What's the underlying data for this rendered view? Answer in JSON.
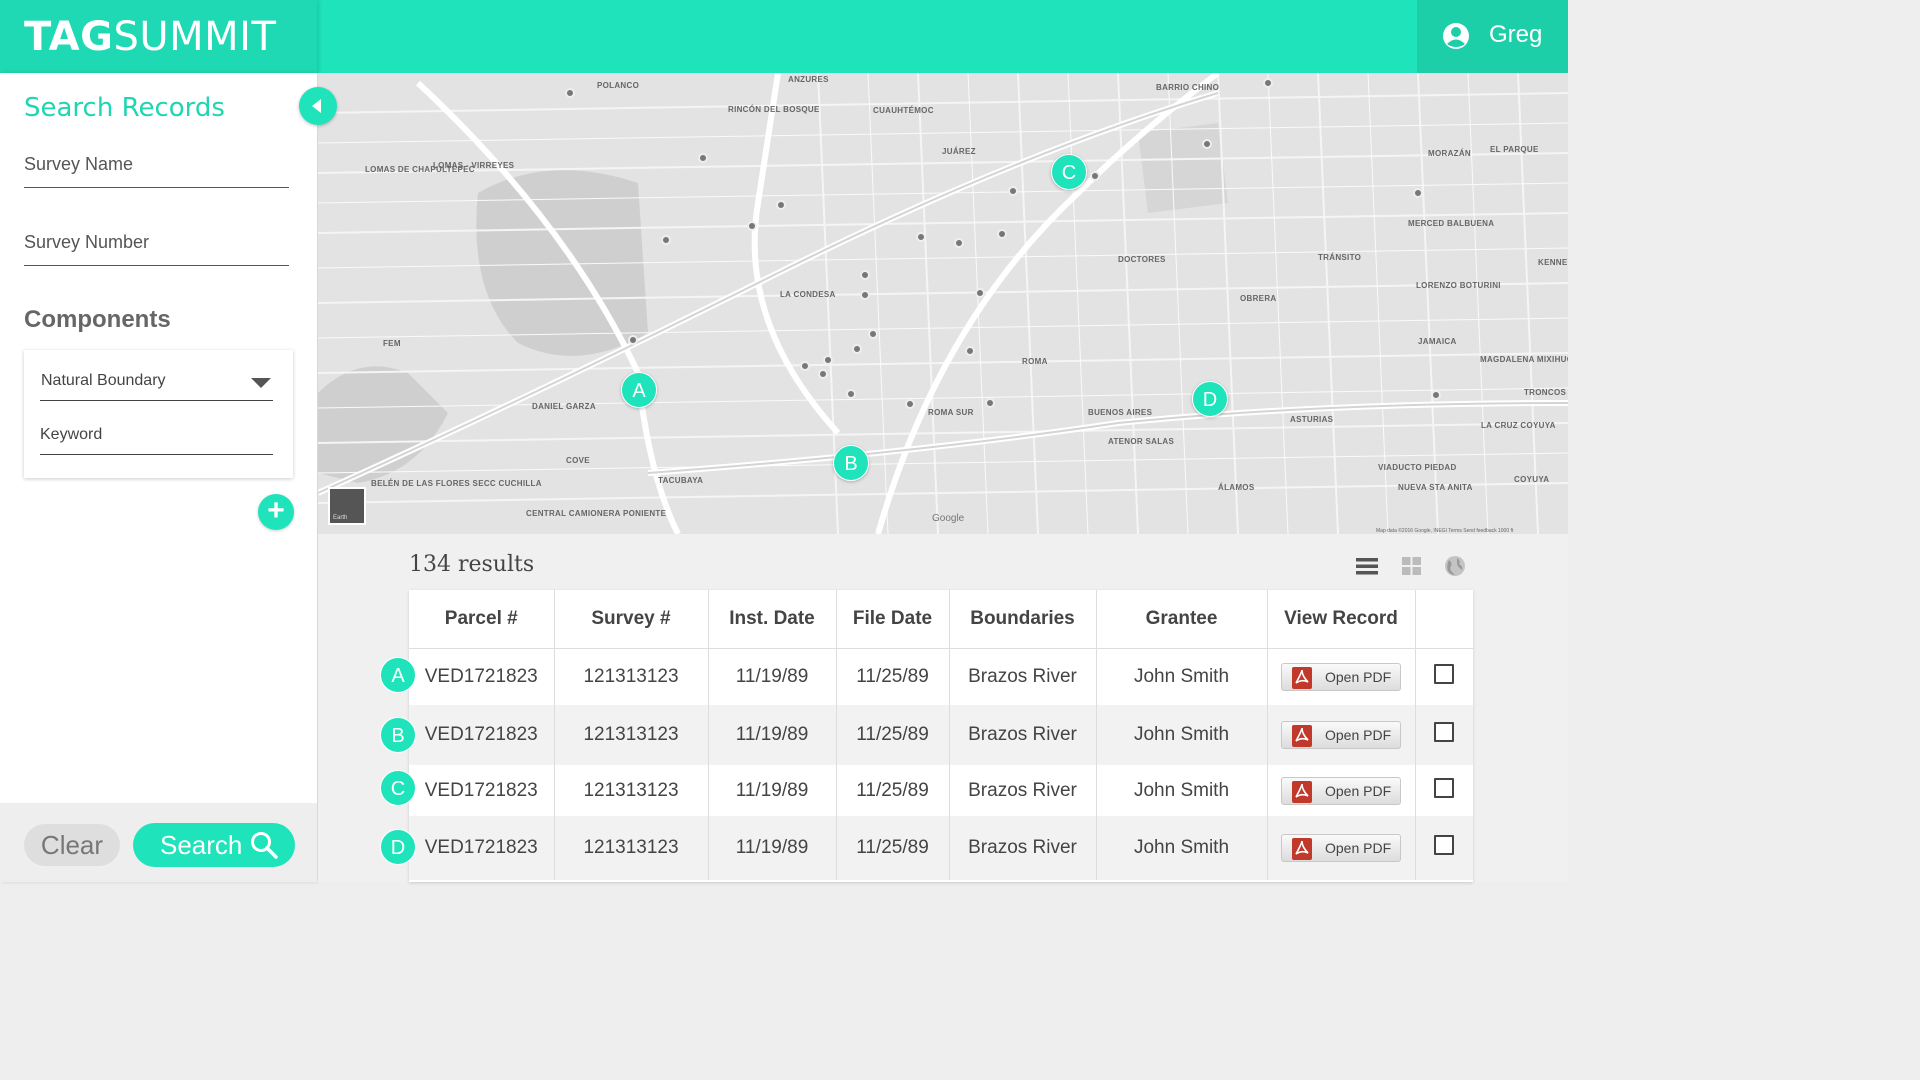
{
  "header": {
    "logo_bold": "TAG",
    "logo_light": "SUMMIT",
    "user_name": "Greg"
  },
  "sidebar": {
    "title": "Search Records",
    "survey_name_placeholder": "Survey Name",
    "survey_number_placeholder": "Survey Number",
    "components_title": "Components",
    "component_select_value": "Natural Boundary",
    "keyword_placeholder": "Keyword",
    "add_label": "+",
    "clear_label": "Clear",
    "search_label": "Search"
  },
  "map": {
    "markers": [
      "A",
      "B",
      "C",
      "D"
    ],
    "labels": [
      "POLANCO",
      "ANZURES",
      "CUAUHTÉMOC",
      "BARRIO CHINO",
      "LOMAS DE CHAPULTEPEC",
      "LOMAS - VIRREYES",
      "RINCÓN DEL BOSQUE",
      "JUÁREZ",
      "MORAZÁN",
      "EL PARQUE",
      "LA CONDESA",
      "DOCTORES",
      "OBRERA",
      "TRÁNSITO",
      "MERCED BALBUENA",
      "LORENZO BOTURINI",
      "ROMA",
      "ROMA SUR",
      "BUENOS AIRES",
      "DANIEL GARZA",
      "COVE",
      "TACUBAYA",
      "ATENOR SALAS",
      "ASTURIAS",
      "VIADUCTO PIEDAD",
      "ÁLAMOS",
      "NUEVA STA ANITA",
      "MAGDALENA MIXIHUCA",
      "JAMAICA",
      "CENTRAL CAMIONERA PONIENTE",
      "BELÉN DE LAS FLORES SECC CUCHILLA",
      "FEM",
      "KENNE",
      "TRONCOS",
      "COYUYA",
      "LA CRUZ COYUYA"
    ],
    "google_text": "Google",
    "earth_text": "Earth",
    "attribution": "Map data ©2016 Google, INEGI   Terms   Send feedback   1000 ft"
  },
  "results": {
    "count_text": "134 results",
    "columns": [
      "Parcel #",
      "Survey #",
      "Inst. Date",
      "File Date",
      "Boundaries",
      "Grantee",
      "View Record",
      ""
    ],
    "rows": [
      {
        "badge": "A",
        "parcel": "VED1721823",
        "survey": "121313123",
        "inst_date": "11/19/89",
        "file_date": "11/25/89",
        "boundaries": "Brazos River",
        "grantee": "John Smith",
        "record_label": "Open PDF"
      },
      {
        "badge": "B",
        "parcel": "VED1721823",
        "survey": "121313123",
        "inst_date": "11/19/89",
        "file_date": "11/25/89",
        "boundaries": "Brazos River",
        "grantee": "John Smith",
        "record_label": "Open PDF"
      },
      {
        "badge": "C",
        "parcel": "VED1721823",
        "survey": "121313123",
        "inst_date": "11/19/89",
        "file_date": "11/25/89",
        "boundaries": "Brazos River",
        "grantee": "John Smith",
        "record_label": "Open PDF"
      },
      {
        "badge": "D",
        "parcel": "VED1721823",
        "survey": "121313123",
        "inst_date": "11/19/89",
        "file_date": "11/25/89",
        "boundaries": "Brazos River",
        "grantee": "John Smith",
        "record_label": "Open PDF"
      }
    ]
  },
  "colors": {
    "accent": "#1fe3bb",
    "accent_dark": "#1ccfa9",
    "title_teal": "#1fd6b1"
  },
  "icons": {
    "user": "account-circle-icon",
    "collapse": "chevron-left-icon",
    "search": "search-icon",
    "list_view": "list-view-icon",
    "grid_view": "grid-view-icon",
    "globe_view": "globe-icon",
    "pdf": "pdf-icon"
  }
}
